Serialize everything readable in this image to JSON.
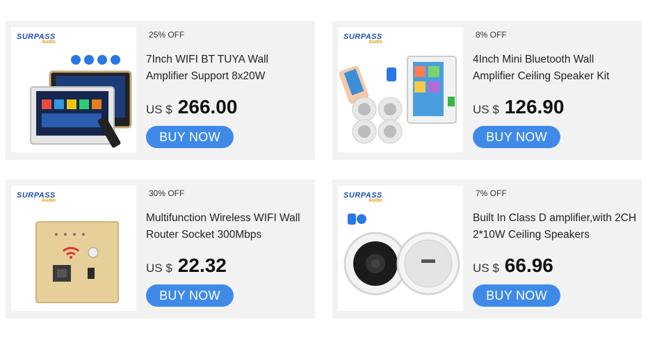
{
  "products": [
    {
      "discount": "25% OFF",
      "title": "7Inch WIFI BT TUYA Wall Amplifier Support 8x20W",
      "currency": "US $",
      "price": "266.00",
      "buy_label": "BUY NOW",
      "brand": "SURPASS",
      "brand_sub": "Audio"
    },
    {
      "discount": "8% OFF",
      "title": "4Inch Mini Bluetooth Wall Amplifier Ceiling Speaker Kit",
      "currency": "US $",
      "price": "126.90",
      "buy_label": "BUY NOW",
      "brand": "SURPASS",
      "brand_sub": "Audio"
    },
    {
      "discount": "30% OFF",
      "title": "Multifunction Wireless WIFI Wall Router Socket 300Mbps",
      "currency": "US $",
      "price": "22.32",
      "buy_label": "BUY NOW",
      "brand": "SURPASS",
      "brand_sub": "Audio"
    },
    {
      "discount": "7% OFF",
      "title": "Built In Class D amplifier,with 2CH 2*10W Ceiling Speakers",
      "currency": "US $",
      "price": "66.96",
      "buy_label": "BUY NOW",
      "brand": "SURPASS",
      "brand_sub": "Audio"
    }
  ],
  "colors": {
    "button": "#3f8ae8",
    "card_bg": "#f2f2f2"
  }
}
